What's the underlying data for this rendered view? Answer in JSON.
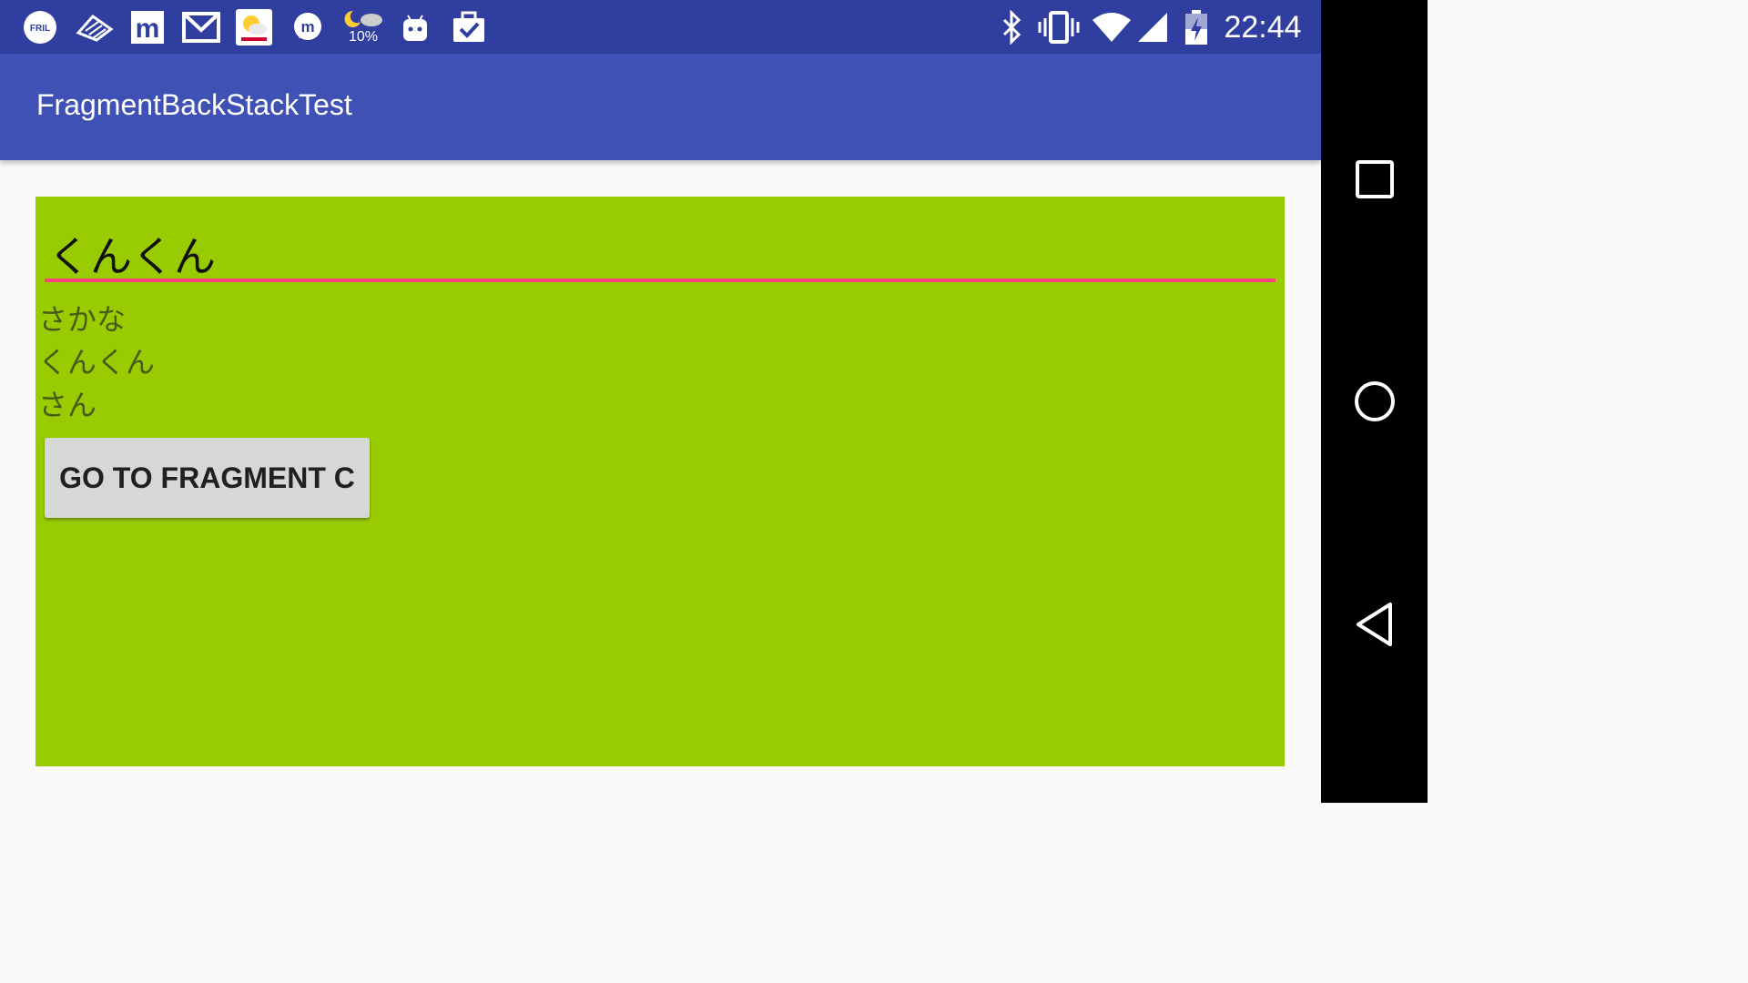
{
  "status_bar": {
    "time": "22:44",
    "weather_percent": "10%",
    "notification_icons": [
      "fril-icon",
      "zebra-app-icon",
      "mercari-icon",
      "gmail-icon",
      "yahoo-weather-icon",
      "messenger-icon",
      "weather-night-cloud-icon",
      "android-debug-icon",
      "clipboard-check-icon"
    ],
    "system_icons": [
      "bluetooth-icon",
      "vibrate-icon",
      "wifi-icon",
      "cell-signal-icon",
      "battery-charging-icon"
    ]
  },
  "app_bar": {
    "title": "FragmentBackStackTest"
  },
  "fragment": {
    "background": "#99cc00",
    "edit_text_value": "くんくん",
    "underline_color": "#ff4081",
    "history": [
      "さかな",
      "くんくん",
      "さん"
    ],
    "button_label": "GO TO FRAGMENT C"
  },
  "nav_bar": {
    "buttons": [
      "recents-button",
      "home-button",
      "back-button"
    ]
  },
  "colors": {
    "status_bar": "#303f9f",
    "app_bar": "#3f51b5",
    "nav_bar": "#000000"
  }
}
